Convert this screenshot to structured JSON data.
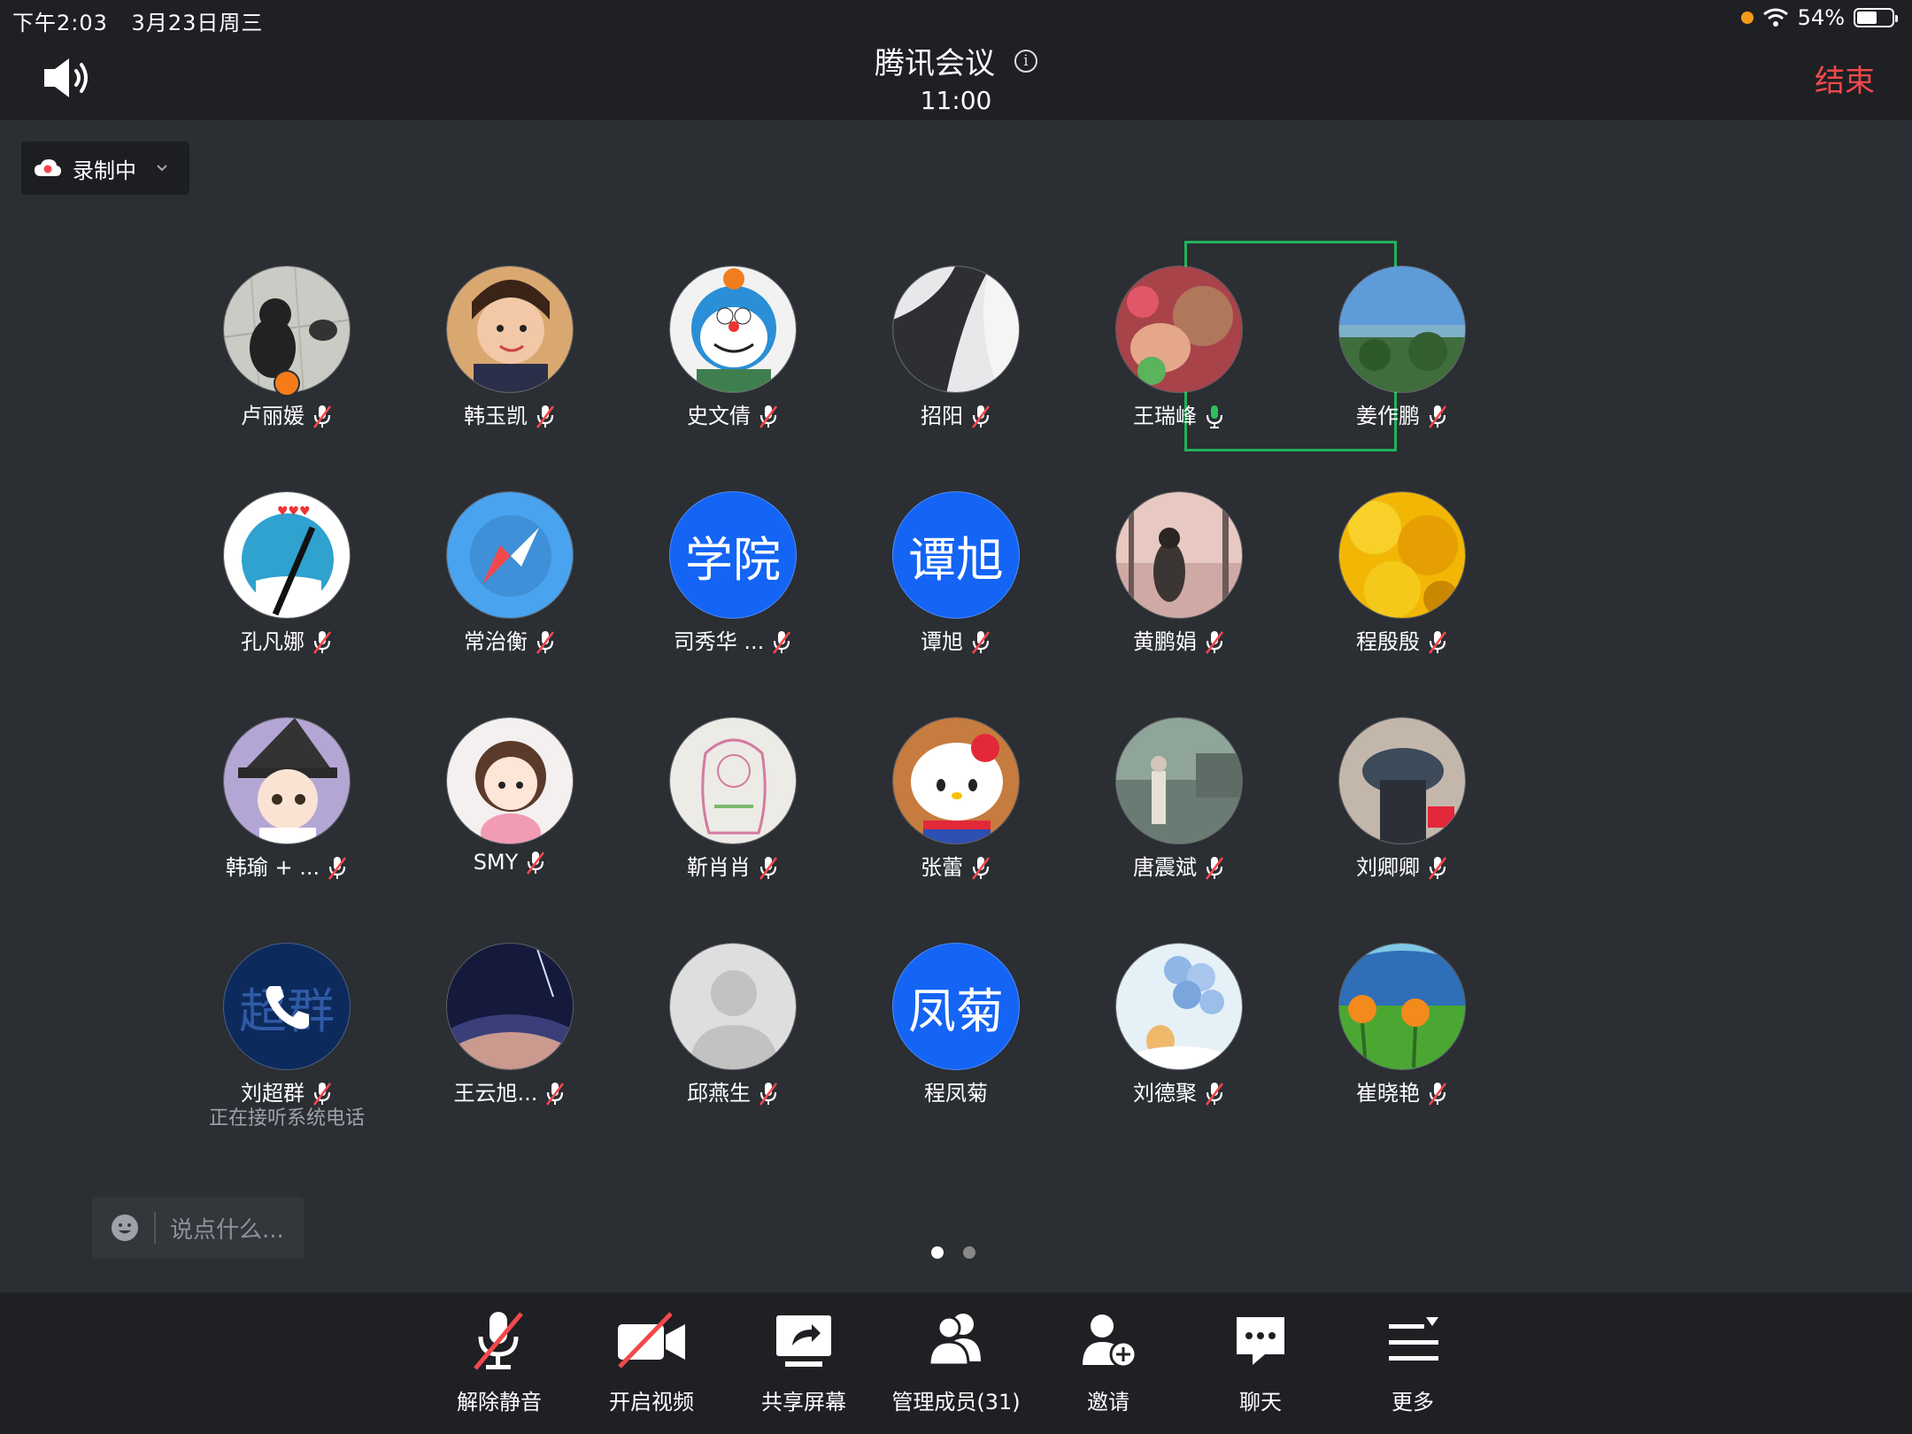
{
  "status_bar": {
    "time": "下午2:03",
    "date": "3月23日周三",
    "battery": "54%"
  },
  "header": {
    "title": "腾讯会议",
    "time": "11:00",
    "end_label": "结束"
  },
  "recording": {
    "label": "录制中"
  },
  "participants": [
    {
      "name": "卢丽媛",
      "mic": "muted",
      "avatar": "photo-penguin"
    },
    {
      "name": "韩玉凯",
      "mic": "muted",
      "avatar": "photo-child"
    },
    {
      "name": "史文倩",
      "mic": "muted",
      "avatar": "doraemon-cartoon"
    },
    {
      "name": "招阳",
      "mic": "muted",
      "avatar": "photo-building"
    },
    {
      "name": "王瑞峰",
      "mic": "active",
      "avatar": "photo-family"
    },
    {
      "name": "姜作鹏",
      "mic": "muted",
      "avatar": "photo-coast"
    },
    {
      "name": "孔凡娜",
      "mic": "muted",
      "avatar": "pencil-drawing"
    },
    {
      "name": "常治衡",
      "mic": "muted",
      "avatar": "compass-icon"
    },
    {
      "name": "司秀华 ...",
      "mic": "muted",
      "avatar_text": "学院"
    },
    {
      "name": "谭旭",
      "mic": "muted",
      "avatar_text": "谭旭"
    },
    {
      "name": "黄鹏娟",
      "mic": "muted",
      "avatar": "photo-beach"
    },
    {
      "name": "程殷殷",
      "mic": "muted",
      "avatar": "photo-flowers"
    },
    {
      "name": "韩瑜 + ...",
      "mic": "muted",
      "avatar": "witch-cartoon"
    },
    {
      "name": "SMY",
      "mic": "muted",
      "avatar": "girl-cartoon"
    },
    {
      "name": "靳肖肖",
      "mic": "muted",
      "avatar": "sketch-drawing"
    },
    {
      "name": "张蕾",
      "mic": "muted",
      "avatar": "hello-kitty"
    },
    {
      "name": "唐震斌",
      "mic": "muted",
      "avatar": "photo-outdoor"
    },
    {
      "name": "刘卿卿",
      "mic": "muted",
      "avatar": "photo-hat"
    },
    {
      "name": "刘超群",
      "mic": "muted",
      "avatar_text": "超群",
      "status": "正在接听系统电话"
    },
    {
      "name": "王云旭...",
      "mic": "muted",
      "avatar": "photo-space"
    },
    {
      "name": "邱燕生",
      "mic": "muted",
      "avatar": "default-avatar"
    },
    {
      "name": "程凤菊",
      "mic": "none",
      "avatar_text": "凤菊"
    },
    {
      "name": "刘德聚",
      "mic": "muted",
      "avatar": "balloon-cartoon"
    },
    {
      "name": "崔晓艳",
      "mic": "muted",
      "avatar": "sunflower-painting"
    }
  ],
  "chat": {
    "placeholder": "说点什么..."
  },
  "page_indicator": {
    "current": 1,
    "total": 2
  },
  "toolbar": {
    "unmute": "解除静音",
    "video": "开启视频",
    "share": "共享屏幕",
    "members": "管理成员(31)",
    "invite": "邀请",
    "chat": "聊天",
    "more": "更多"
  },
  "colors": {
    "accent_blue": "#1464f5",
    "end_red": "#f2484b",
    "active_green": "#22b35a"
  }
}
